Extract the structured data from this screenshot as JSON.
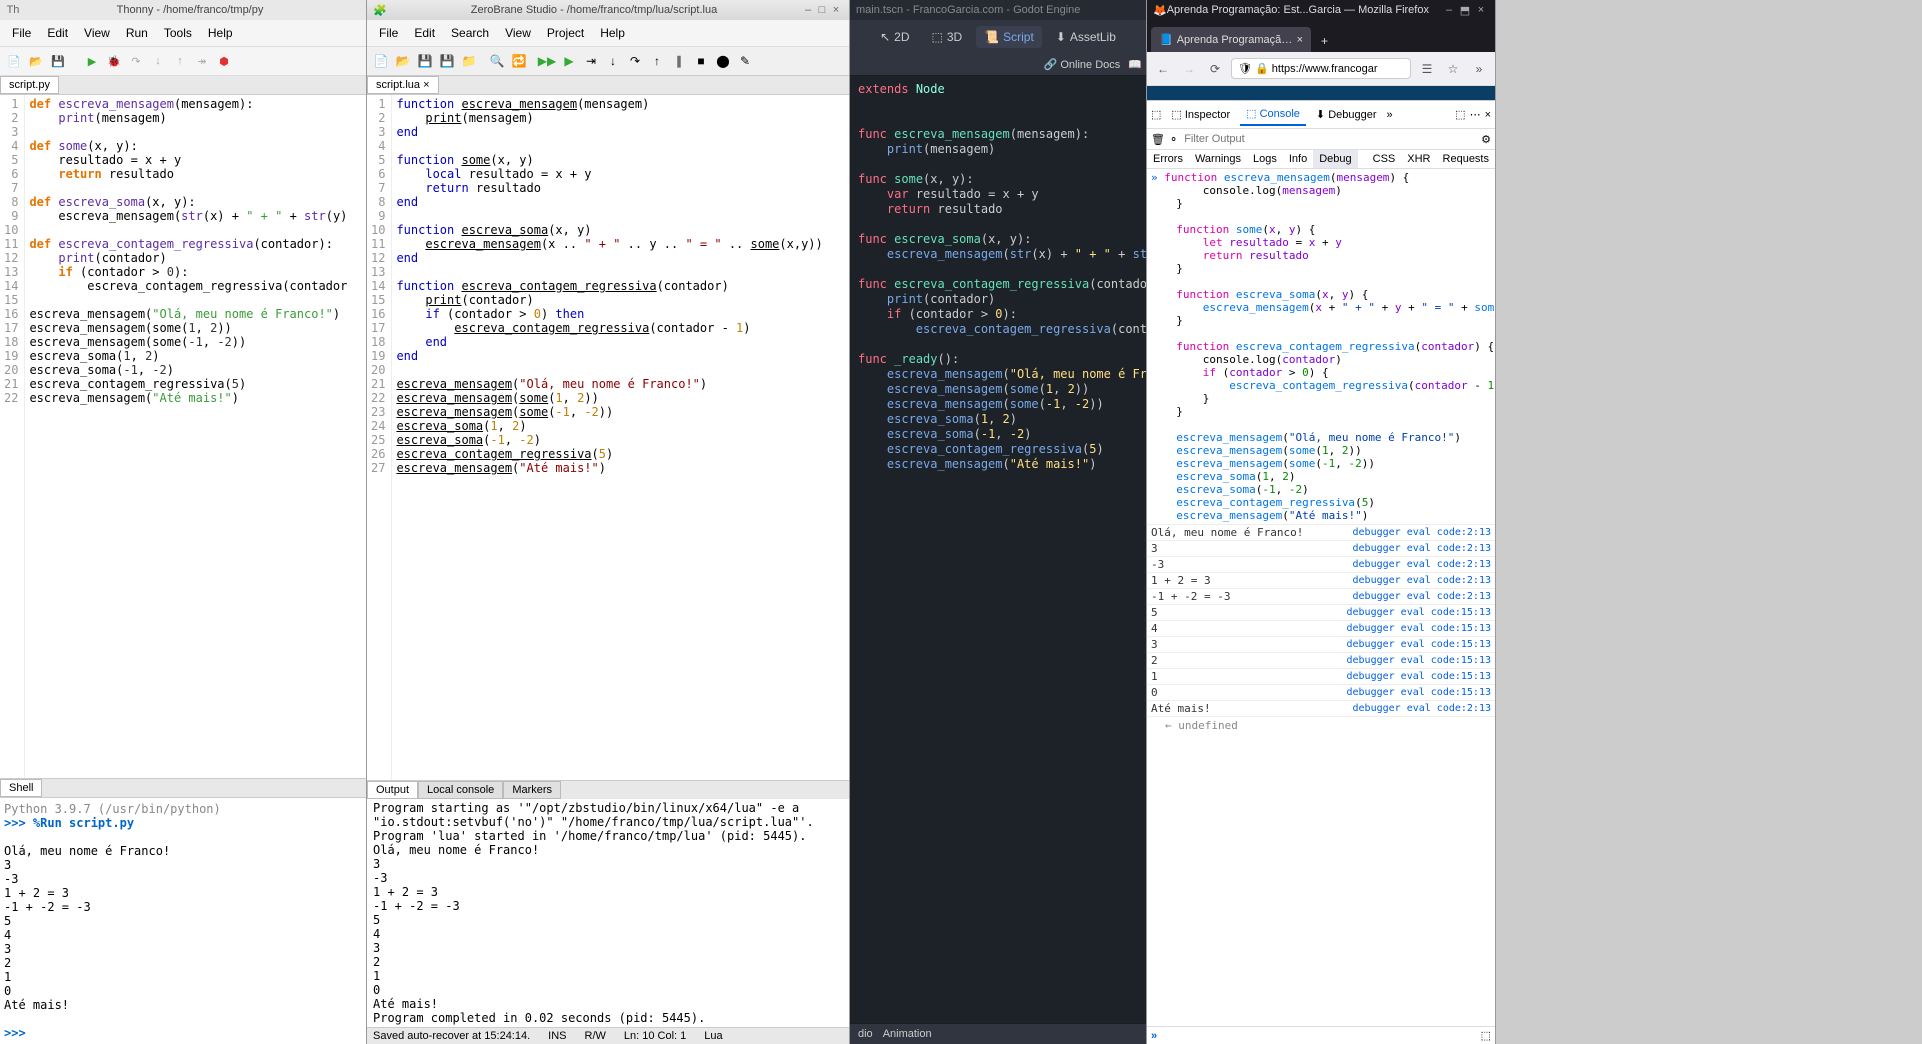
{
  "thonny": {
    "title": "Thonny - /home/franco/tmp/py",
    "menu": [
      "File",
      "Edit",
      "View",
      "Run",
      "Tools",
      "Help"
    ],
    "tab": "script.py",
    "gutter": " 1\n 2\n 3\n 4\n 5\n 6\n 7\n 8\n 9\n10\n11\n12\n13\n14\n15\n16\n17\n18\n19\n20\n21\n22",
    "shell_tab": "Shell",
    "shell_header": "Python 3.9.7 (/usr/bin/python)",
    "shell_run": ">>> %Run script.py",
    "shell_out": "Olá, meu nome é Franco!\n3\n-3\n1 + 2 = 3\n-1 + -2 = -3\n5\n4\n3\n2\n1\n0\nAté mais!",
    "shell_prompt": ">>>"
  },
  "zerobrane": {
    "title": "ZeroBrane Studio - /home/franco/tmp/lua/script.lua",
    "menu": [
      "File",
      "Edit",
      "Search",
      "View",
      "Project",
      "Help"
    ],
    "tab": "script.lua",
    "gutter": " 1\n 2\n 3\n 4\n 5\n 6\n 7\n 8\n 9\n10\n11\n12\n13\n14\n15\n16\n17\n18\n19\n20\n21\n22\n23\n24\n25\n26\n27",
    "output_tabs": [
      "Output",
      "Local console",
      "Markers"
    ],
    "output": "Program starting as '\"/opt/zbstudio/bin/linux/x64/lua\" -e a\n\"io.stdout:setvbuf('no')\" \"/home/franco/tmp/lua/script.lua\"'.\nProgram 'lua' started in '/home/franco/tmp/lua' (pid: 5445).\nOlá, meu nome é Franco!\n3\n-3\n1 + 2 = 3\n-1 + -2 = -3\n5\n4\n3\n2\n1\n0\nAté mais!\nProgram completed in 0.02 seconds (pid: 5445).",
    "status": {
      "save": "Saved auto-recover at 15:24:14.",
      "mode": "INS",
      "rw": "R/W",
      "pos": "Ln: 10 Col: 1",
      "lang": "Lua"
    }
  },
  "godot": {
    "title": "main.tscn - FrancoGarcia.com - Godot Engine",
    "top": {
      "2d": "2D",
      "3d": "3D",
      "script": "Script",
      "asset": "AssetLib"
    },
    "docs": "Online Docs",
    "bottom": [
      "dio",
      "Animation"
    ]
  },
  "firefox": {
    "title": "Aprenda Programação: Est...Garcia — Mozilla Firefox",
    "tab": "Aprenda Programação: Estru",
    "url": "https://www.francogar",
    "devtools": {
      "tabs": {
        "inspector": "Inspector",
        "console": "Console",
        "debugger": "Debugger"
      },
      "filter_placeholder": "Filter Output",
      "cats": [
        "Errors",
        "Warnings",
        "Logs",
        "Info",
        "Debug",
        "CSS",
        "XHR",
        "Requests"
      ],
      "logs": [
        {
          "v": "Olá, meu nome é Franco!",
          "src": "debugger eval code:2:13"
        },
        {
          "v": "3",
          "src": "debugger eval code:2:13"
        },
        {
          "v": "-3",
          "src": "debugger eval code:2:13"
        },
        {
          "v": "1 + 2 = 3",
          "src": "debugger eval code:2:13"
        },
        {
          "v": "-1 + -2 = -3",
          "src": "debugger eval code:2:13"
        },
        {
          "v": "5",
          "src": "debugger eval code:15:13"
        },
        {
          "v": "4",
          "src": "debugger eval code:15:13"
        },
        {
          "v": "3",
          "src": "debugger eval code:15:13"
        },
        {
          "v": "2",
          "src": "debugger eval code:15:13"
        },
        {
          "v": "1",
          "src": "debugger eval code:15:13"
        },
        {
          "v": "0",
          "src": "debugger eval code:15:13"
        },
        {
          "v": "Até mais!",
          "src": "debugger eval code:2:13"
        }
      ],
      "undefined": "undefined"
    }
  }
}
